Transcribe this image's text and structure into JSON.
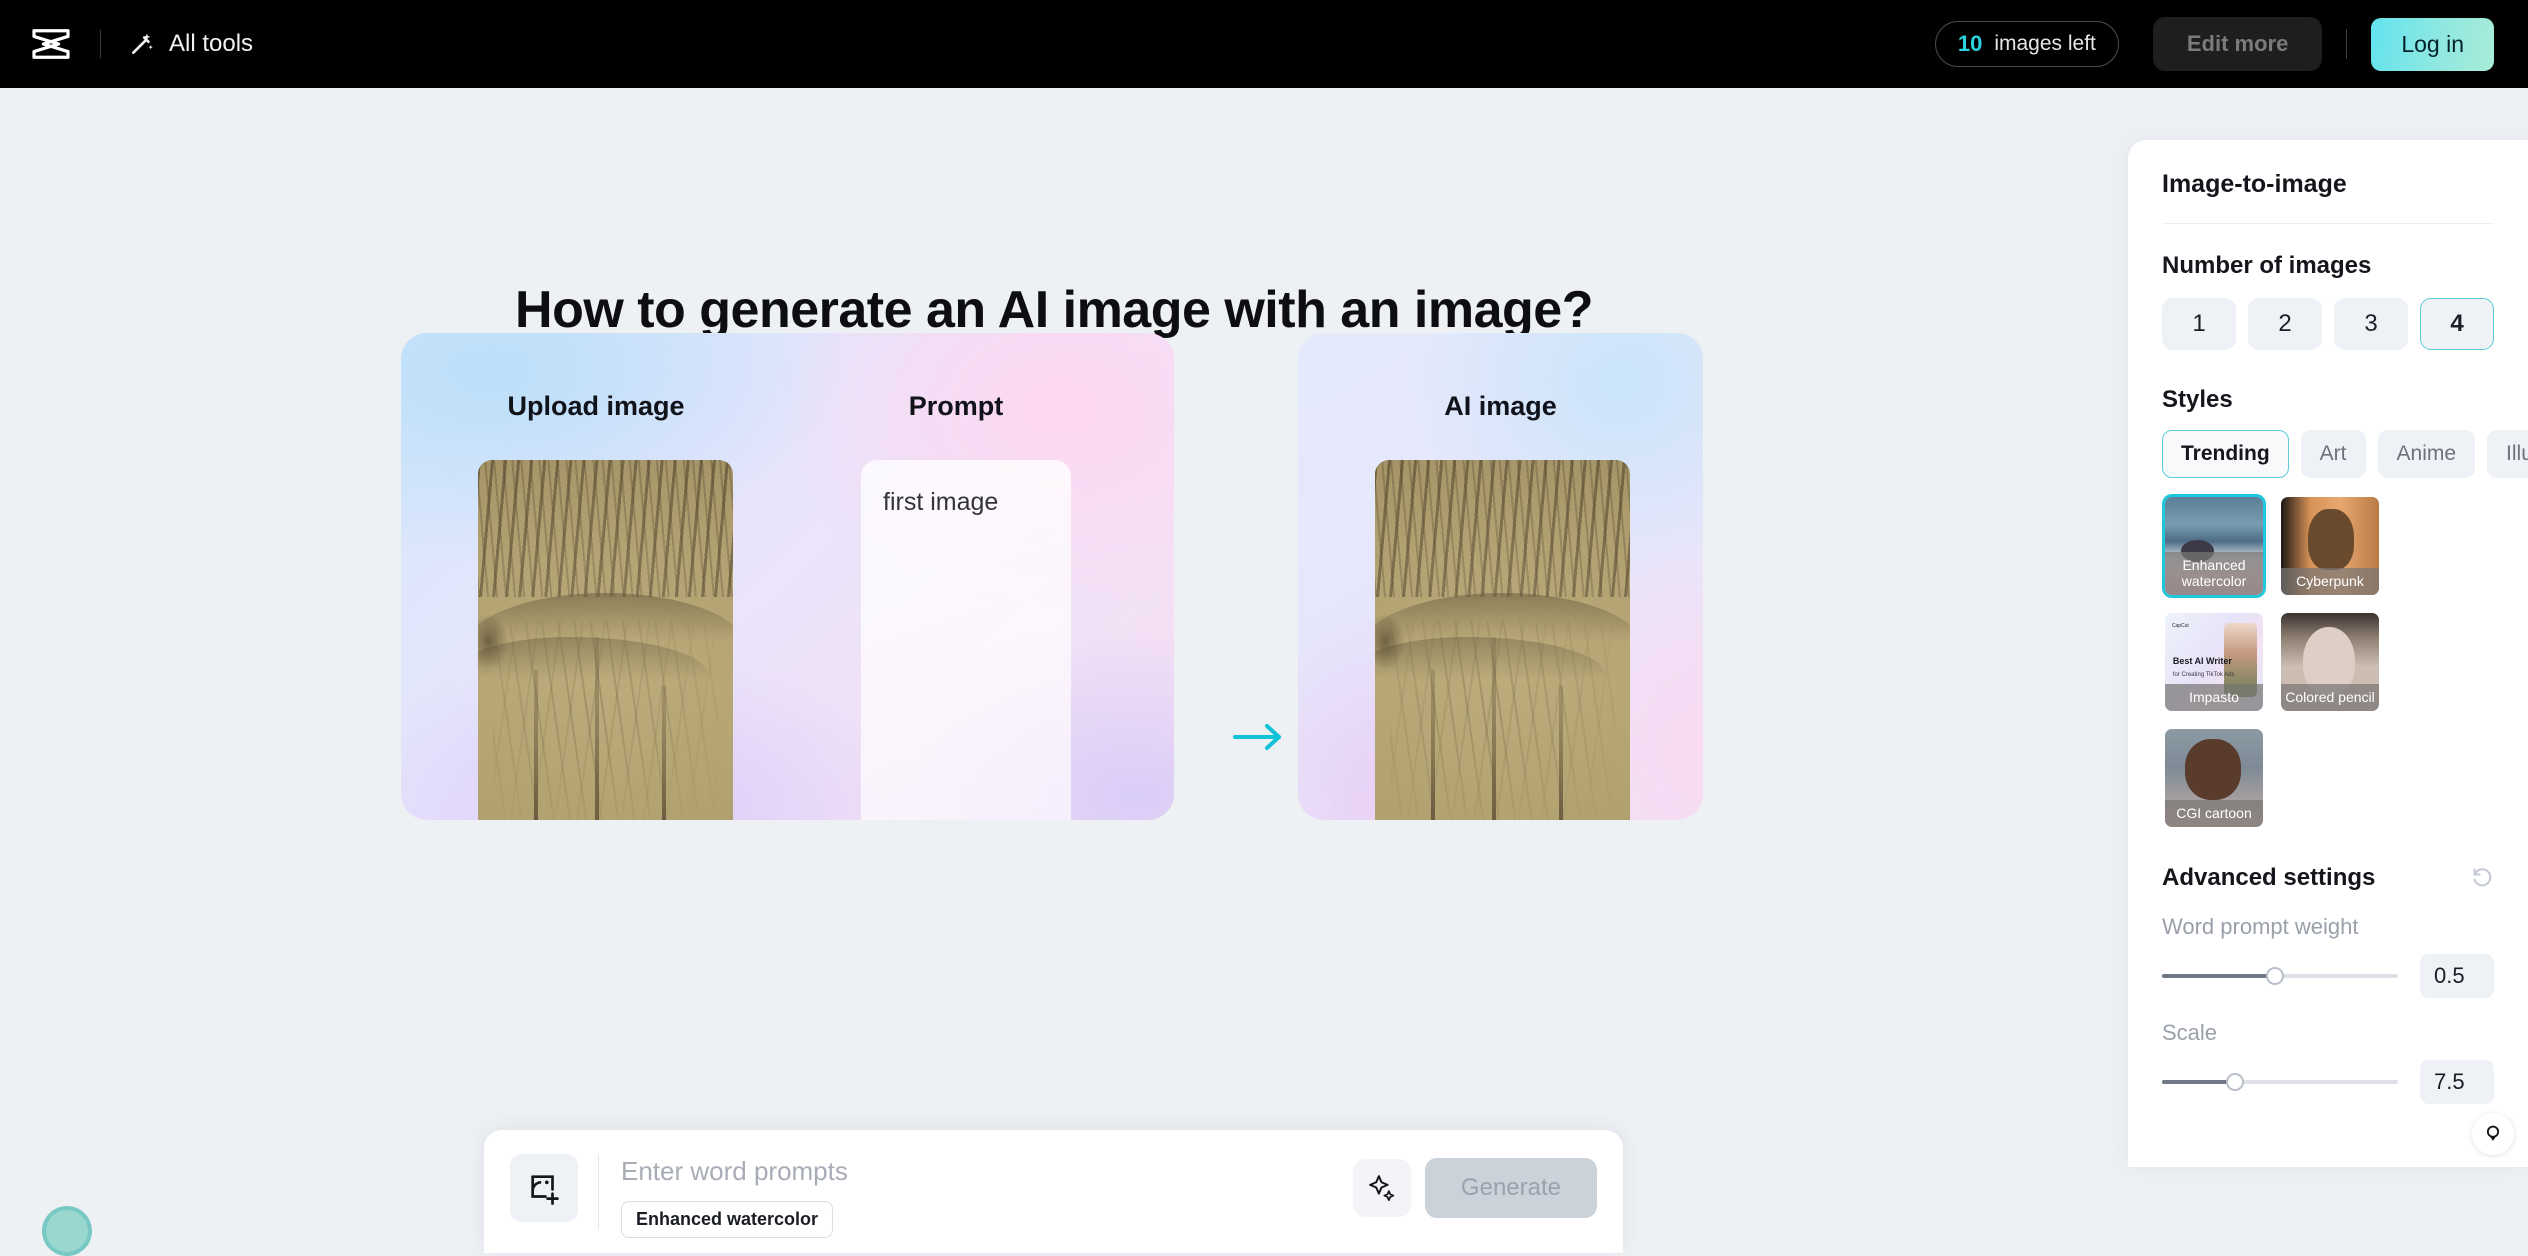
{
  "header": {
    "logo_icon": "capcut-logo-icon",
    "all_tools_label": "All tools",
    "wand_icon": "magic-wand-icon",
    "images_left_count": "10",
    "images_left_label": "images left",
    "edit_more_label": "Edit more",
    "login_label": "Log in",
    "accent_cyan": "#2ad4e0"
  },
  "main": {
    "page_title": "How to generate an AI image with an image?",
    "upload_label": "Upload image",
    "prompt_label": "Prompt",
    "prompt_value": "first image",
    "ai_image_label": "AI image",
    "plus_icon": "plus-icon",
    "arrow_icon": "arrow-right-icon"
  },
  "prompt_bar": {
    "upload_icon": "add-image-icon",
    "placeholder": "Enter word prompts",
    "style_chip": "Enhanced watercolor",
    "sparkle_icon": "sparkle-icon",
    "generate_label": "Generate"
  },
  "panel": {
    "title": "Image-to-image",
    "number_of_images": {
      "heading": "Number of images",
      "options": [
        "1",
        "2",
        "3",
        "4"
      ],
      "selected": "4"
    },
    "styles": {
      "heading": "Styles",
      "chips": [
        "Trending",
        "Art",
        "Anime",
        "Illustration"
      ],
      "chip_selected": "Trending",
      "thumbs": [
        {
          "label": "Enhanced watercolor",
          "selected": true
        },
        {
          "label": "Cyberpunk",
          "selected": false
        },
        {
          "label": "Impasto",
          "selected": false
        },
        {
          "label": "Colored pencil",
          "selected": false
        },
        {
          "label": "CGI cartoon",
          "selected": false
        }
      ],
      "impasto_thumb": {
        "logo": "CapCut",
        "headline": "Best AI Writer",
        "subline": "for Creating TikTok Ads"
      }
    },
    "advanced": {
      "heading": "Advanced settings",
      "reset_icon": "reset-icon",
      "word_prompt_weight_label": "Word prompt weight",
      "word_prompt_weight_value": "0.5",
      "word_prompt_weight_percent": 48,
      "scale_label": "Scale",
      "scale_value": "7.5",
      "scale_percent": 31
    },
    "selection_border_color": "#5ecbd6"
  },
  "floating": {
    "circle_icon": "floating-action-circle",
    "help_icon": "lightbulb-help-icon"
  }
}
